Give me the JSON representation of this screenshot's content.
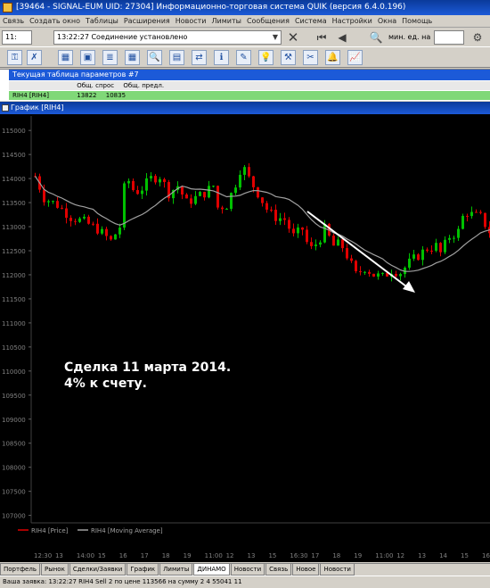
{
  "window": {
    "title": "[39464 - SIGNAL-EUM UID: 27304] Информационно-торговая система QUIK (версия 6.4.0.196)"
  },
  "menu": [
    "Связь",
    "Создать окно",
    "Таблицы",
    "Расширения",
    "Новости",
    "Лимиты",
    "Сообщения",
    "Система",
    "Настройки",
    "Окна",
    "Помощь"
  ],
  "toolbar": {
    "time_field": "11:",
    "status_text": "13:22:27 Соединение установлено",
    "search_label": "Найти:",
    "search_hint": "мин. ед. на"
  },
  "params_window": {
    "title": "Текущая таблица параметров #7",
    "headers": [
      "Общ. спрос",
      "Общ. предл."
    ],
    "row": [
      "RIH4 [RIH4]",
      "13822",
      "10835"
    ]
  },
  "chart_window": {
    "title": "График [RIH4]"
  },
  "chart_data": {
    "type": "candlestick",
    "series": [
      {
        "name": "RIH4 [Price]",
        "color": "#e00000"
      },
      {
        "name": "RIH4 [Moving Average]",
        "color": "#a0a0a0"
      }
    ],
    "colors": {
      "up": "#00c000",
      "down": "#e00000",
      "ma": "#a0a0a0",
      "arrow": "#ffffff"
    },
    "y_ticks": [
      115000,
      114500,
      114000,
      113500,
      113000,
      112500,
      112000,
      111500,
      111000,
      110500,
      110000,
      109500,
      109000,
      108500,
      108000,
      107500,
      107000
    ],
    "ylim": [
      106900,
      115300
    ],
    "x_ticks": [
      "12:30",
      "13",
      "14:00",
      "15",
      "16",
      "17",
      "18",
      "19",
      "11:00",
      "12",
      "13",
      "15",
      "16:30",
      "17",
      "18",
      "19",
      "11:00",
      "12",
      "13",
      "14",
      "15",
      "16"
    ],
    "annotation_line1": "Сделка 11 марта 2014.",
    "annotation_line2": "4% к счету."
  },
  "tabs": [
    "Портфель",
    "Рынок",
    "Сделки/Заявки",
    "График",
    "Лимиты",
    "ДИНАМО",
    "Новости",
    "Связь",
    "Новое",
    "Новости"
  ],
  "status": "Ваша заявка: 13:22:27 RIH4 Sell 2 по цене 113566 на сумму 2 4 55041 11"
}
